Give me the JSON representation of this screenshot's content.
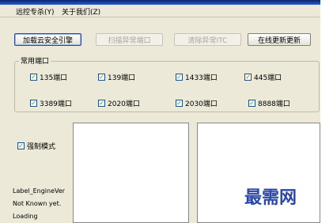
{
  "menu": {
    "items": [
      "远控专杀(Y)",
      "关于我们(Z)"
    ]
  },
  "toolbar": {
    "btn_load": "加载云安全引擎",
    "btn_scan": "扫描异常端口",
    "btn_clear": "清除异常ITC",
    "btn_update": "在线更新更新"
  },
  "ports": {
    "group_label": "常用端口",
    "items": [
      "135端口",
      "139端口",
      "1433端口",
      "445端口",
      "3389端口",
      "2020端口",
      "2030端口",
      "8888端口"
    ]
  },
  "mode": {
    "force_label": "强制模式"
  },
  "status": {
    "engine": "Label_EngineVer",
    "known": "Not Known yet.",
    "loading": "Loading"
  },
  "watermark": "最需网"
}
